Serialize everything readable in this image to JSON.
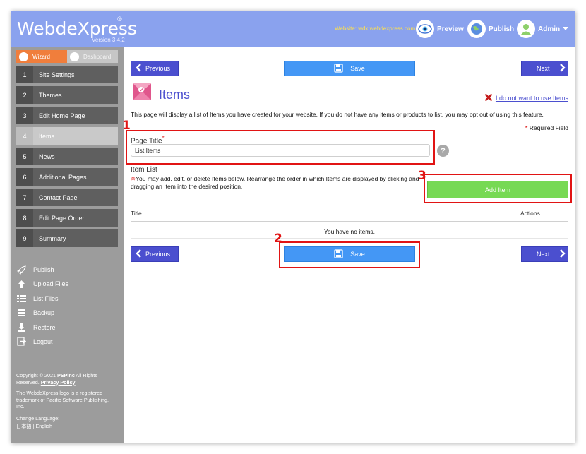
{
  "header": {
    "logo": "WebdeXpress",
    "registered": "®",
    "version": "Version 3.4.2",
    "site_url": "Website: wdx.webdexpress.com",
    "preview_label": "Preview",
    "publish_label": "Publish",
    "admin_label": "Admin"
  },
  "sidebar": {
    "modes": {
      "wizard": "Wizard",
      "dashboard": "Dashboard"
    },
    "steps": [
      {
        "num": "1",
        "label": "Site Settings"
      },
      {
        "num": "2",
        "label": "Themes"
      },
      {
        "num": "3",
        "label": "Edit Home Page"
      },
      {
        "num": "4",
        "label": "Items"
      },
      {
        "num": "5",
        "label": "News"
      },
      {
        "num": "6",
        "label": "Additional Pages"
      },
      {
        "num": "7",
        "label": "Contact Page"
      },
      {
        "num": "8",
        "label": "Edit Page Order"
      },
      {
        "num": "9",
        "label": "Summary"
      }
    ],
    "tools": [
      {
        "label": "Publish",
        "icon": "rocket-icon"
      },
      {
        "label": "Upload Files",
        "icon": "upload-icon"
      },
      {
        "label": "List Files",
        "icon": "list-icon"
      },
      {
        "label": "Backup",
        "icon": "database-icon"
      },
      {
        "label": "Restore",
        "icon": "download-icon"
      },
      {
        "label": "Logout",
        "icon": "logout-icon"
      }
    ],
    "copyright_pre": "Copyright © 2021",
    "copyright_company": "PSPinc",
    "copyright_post": " All Rights Reserved.",
    "privacy_policy": "Privacy Policy",
    "trademark": "The WebdeXpress logo is a registered trademark of Pacific Software Publishing, Inc.",
    "change_language": "Change Language:",
    "lang_jp": "日本語",
    "lang_sep": "|",
    "lang_en": "English"
  },
  "main": {
    "previous_label": "Previous",
    "save_label": "Save",
    "next_label": "Next",
    "title": "Items",
    "optout_label": "I do not want to use Items",
    "description": "This page will display a list of Items you have created for your website. If you do not have any items or products to list, you may opt out of using this feature.",
    "required_mark": "*",
    "required_text": " Required Field",
    "page_title_label": "Page Title",
    "page_title_value": "List Items",
    "help": "?",
    "item_list_label": "Item List",
    "note_mark": "※",
    "item_list_note": "You may add, edit, or delete Items below. Rearrange the order in which Items are displayed by clicking and dragging an Item into the desired position.",
    "add_item_label": "Add Item",
    "col_title": "Title",
    "col_actions": "Actions",
    "empty_text": "You have no items."
  },
  "annotations": [
    "1",
    "2",
    "3"
  ],
  "colors": {
    "header": "#8aa2ee",
    "nav_button": "#4b4fcf",
    "save_button": "#4497f5",
    "add_button": "#77d954",
    "wizard_tab": "#f07e3c",
    "annotation": "#e11414"
  }
}
